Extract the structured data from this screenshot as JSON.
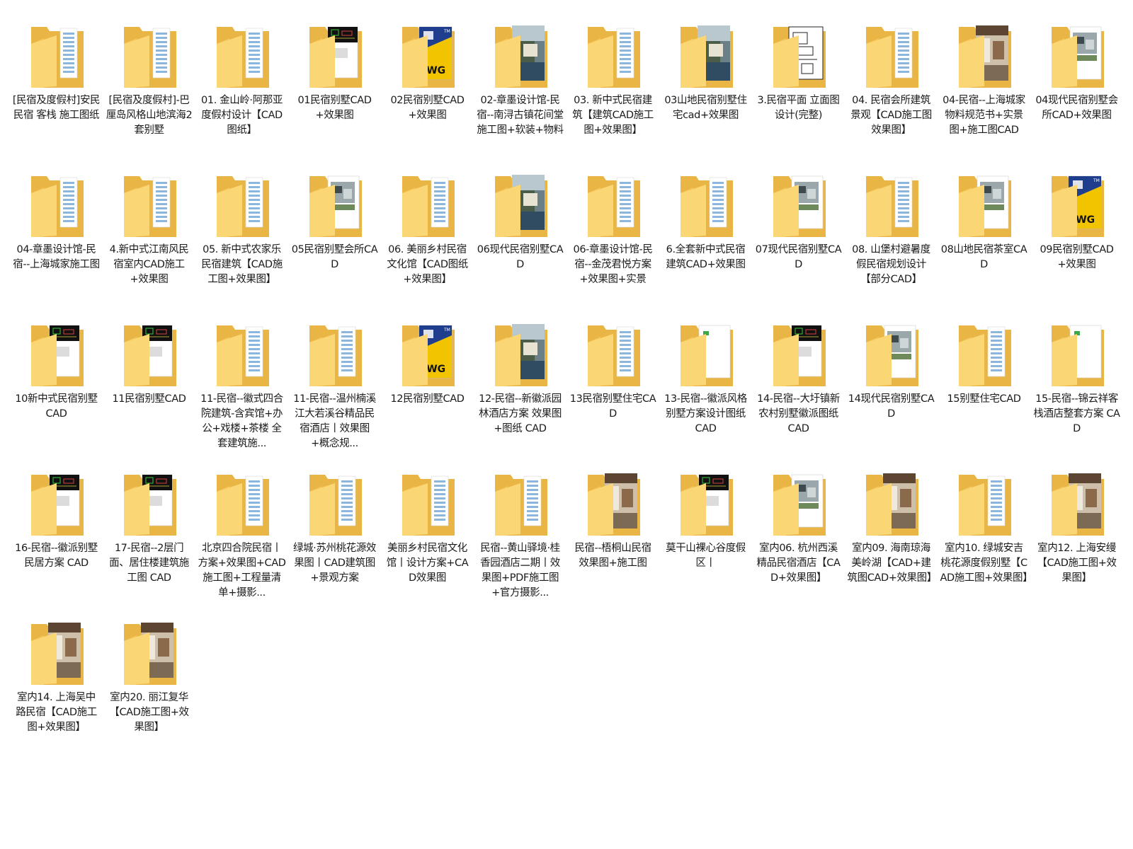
{
  "colors": {
    "folder_back": "#e9b646",
    "folder_front": "#fbd675",
    "folder_front_shade": "#f4c65a",
    "label_text": "#1a1a1a"
  },
  "icon_name": "folder-icon",
  "folders": [
    {
      "label": "[民宿及度假村]安民民宿 客栈 施工图纸",
      "preview": "doc"
    },
    {
      "label": "[民宿及度假村]-巴厘岛风格山地滨海2套别墅",
      "preview": "doc"
    },
    {
      "label": "01. 金山岭·阿那亚度假村设计【CAD图纸】",
      "preview": "doc"
    },
    {
      "label": "01民宿别墅CAD+效果图",
      "preview": "cad"
    },
    {
      "label": "02民宿别墅CAD+效果图",
      "preview": "dwg"
    },
    {
      "label": "02-章墨设计馆-民宿--南浔古镇花间堂 施工图+软装+物料",
      "preview": "photo"
    },
    {
      "label": "03. 新中式民宿建筑【建筑CAD施工图+效果图】",
      "preview": "doc"
    },
    {
      "label": "03山地民宿别墅住宅cad+效果图",
      "preview": "photo"
    },
    {
      "label": "3.民宿平面 立面图设计(完整)",
      "preview": "plan"
    },
    {
      "label": "04. 民宿会所建筑景观【CAD施工图效果图】",
      "preview": "doc"
    },
    {
      "label": "04-民宿--上海城家 物料规范书+实景图+施工图CAD",
      "preview": "interior"
    },
    {
      "label": "04现代民宿别墅会所CAD+效果图",
      "preview": "render"
    },
    {
      "label": "04-章墨设计馆-民宿--上海城家施工图",
      "preview": "doc"
    },
    {
      "label": "4.新中式江南风民宿室内CAD施工+效果图",
      "preview": "doc"
    },
    {
      "label": "05. 新中式农家乐民宿建筑【CAD施工图+效果图】",
      "preview": "doc"
    },
    {
      "label": "05民宿别墅会所CAD",
      "preview": "render"
    },
    {
      "label": "06. 美丽乡村民宿文化馆【CAD图纸+效果图】",
      "preview": "doc"
    },
    {
      "label": "06现代民宿别墅CAD",
      "preview": "photo"
    },
    {
      "label": "06-章墨设计馆-民宿--金茂君悦方案+效果图+实景",
      "preview": "doc"
    },
    {
      "label": "6.全套新中式民宿建筑CAD+效果图",
      "preview": "doc"
    },
    {
      "label": "07现代民宿别墅CAD",
      "preview": "render"
    },
    {
      "label": "08. 山堡村避暑度假民宿规划设计【部分CAD】",
      "preview": "doc"
    },
    {
      "label": "08山地民宿茶室CAD",
      "preview": "render"
    },
    {
      "label": "09民宿别墅CAD+效果图",
      "preview": "dwg"
    },
    {
      "label": "10新中式民宿别墅CAD",
      "preview": "cad"
    },
    {
      "label": "11民宿别墅CAD",
      "preview": "cad"
    },
    {
      "label": "11-民宿--徽式四合院建筑-含宾馆+办公+戏楼+茶楼 全套建筑施...",
      "preview": "doc"
    },
    {
      "label": "11-民宿--温州楠溪江大若溪谷精品民宿酒店丨效果图+概念规...",
      "preview": "doc"
    },
    {
      "label": "12民宿别墅CAD",
      "preview": "dwg"
    },
    {
      "label": "12-民宿--新徽派园林酒店方案 效果图+图纸 CAD",
      "preview": "photo"
    },
    {
      "label": "13民宿别墅住宅CAD",
      "preview": "doc"
    },
    {
      "label": "13-民宿--徽派风格别墅方案设计图纸 CAD",
      "preview": "blank"
    },
    {
      "label": "14-民宿--大圩镇新农村别墅徽派图纸 CAD",
      "preview": "cad"
    },
    {
      "label": "14现代民宿别墅CAD",
      "preview": "render"
    },
    {
      "label": "15别墅住宅CAD",
      "preview": "doc"
    },
    {
      "label": "15-民宿--锦云祥客栈酒店整套方案 CAD",
      "preview": "blank"
    },
    {
      "label": "16-民宿--徽派别墅民居方案 CAD",
      "preview": "cad"
    },
    {
      "label": "17-民宿--2层门面、居住楼建筑施工图 CAD",
      "preview": "cad"
    },
    {
      "label": "北京四合院民宿丨方案+效果图+CAD施工图+工程量清单+摄影...",
      "preview": "doc"
    },
    {
      "label": "绿城·苏州桃花源效果图丨CAD建筑图+景观方案",
      "preview": "doc"
    },
    {
      "label": "美丽乡村民宿文化馆丨设计方案+CAD效果图",
      "preview": "doc"
    },
    {
      "label": "民宿--黄山驿境·桂香园酒店二期丨效果图+PDF施工图+官方摄影...",
      "preview": "doc"
    },
    {
      "label": "民宿--梧桐山民宿 效果图+施工图",
      "preview": "interior"
    },
    {
      "label": "莫干山裸心谷度假区丨",
      "preview": "cad"
    },
    {
      "label": "室内06. 杭州西溪精品民宿酒店【CAD+效果图】",
      "preview": "render"
    },
    {
      "label": "室内09. 海南琼海美岭湖【CAD+建筑图CAD+效果图】",
      "preview": "interior"
    },
    {
      "label": "室内10. 绿城安吉桃花源度假别墅【CAD施工图+效果图】",
      "preview": "doc"
    },
    {
      "label": "室内12. 上海安缦【CAD施工图+效果图】",
      "preview": "interior"
    },
    {
      "label": "室内14. 上海吴中路民宿【CAD施工图+效果图】",
      "preview": "interior"
    },
    {
      "label": "室内20. 丽江复华【CAD施工图+效果图】",
      "preview": "interior"
    }
  ]
}
